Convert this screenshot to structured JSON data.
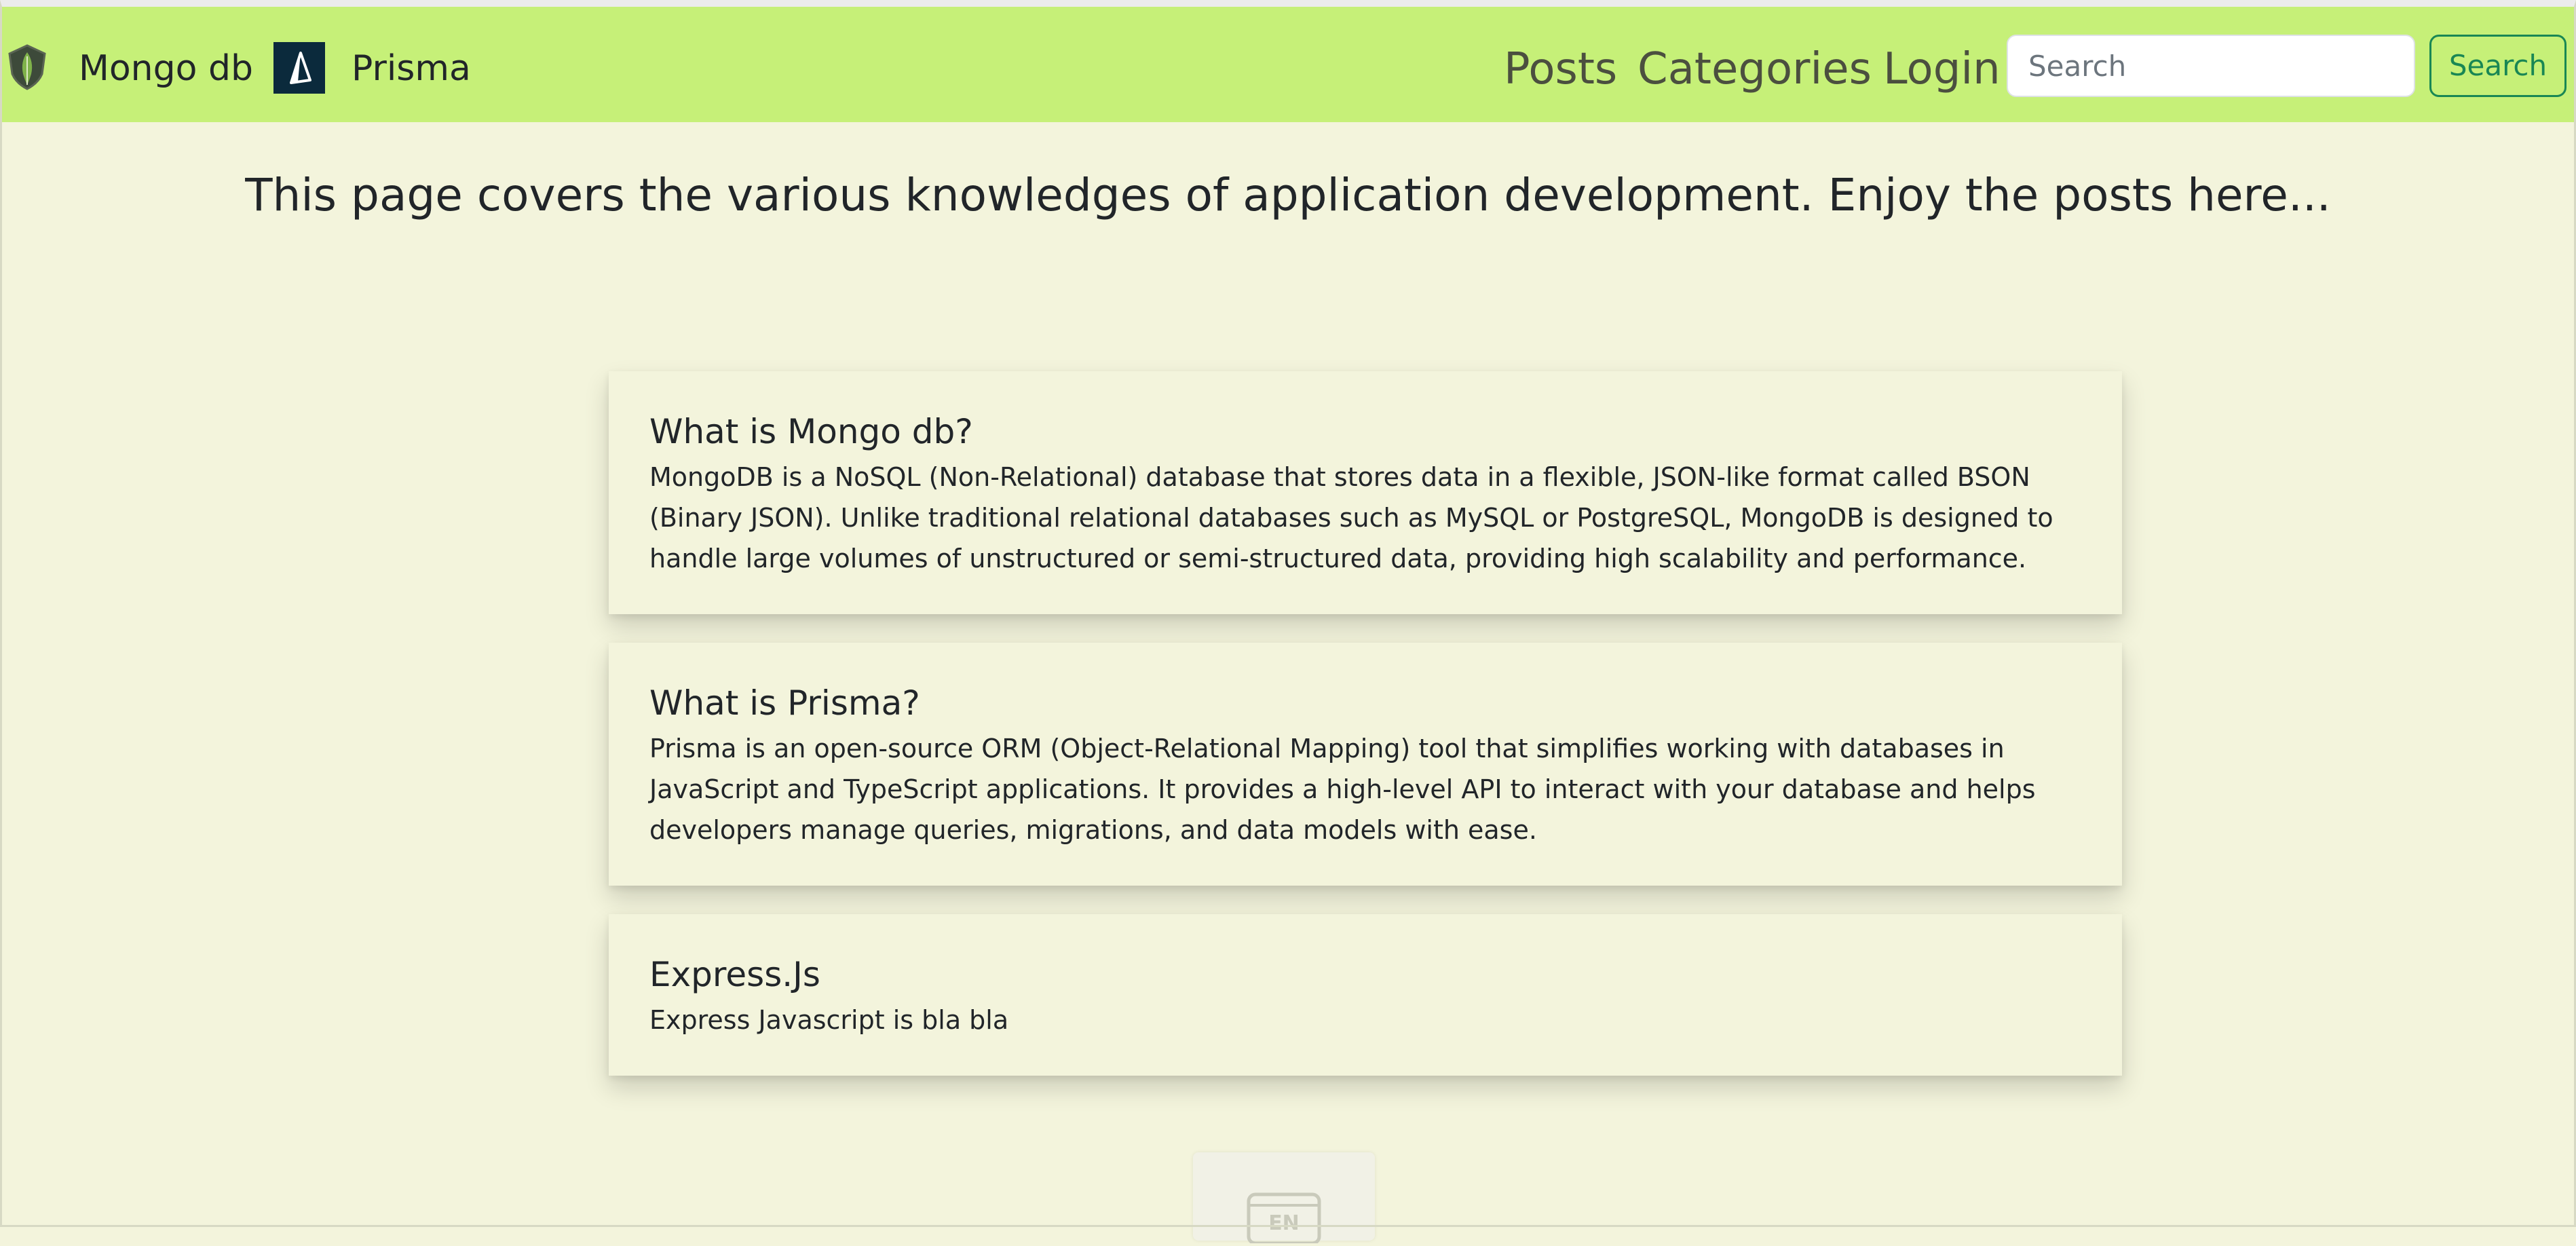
{
  "navbar": {
    "brand_mongo": {
      "label": "Mongo db",
      "icon": "mongodb-leaf-icon"
    },
    "brand_prisma": {
      "label": "Prisma",
      "icon": "prisma-triangle-icon"
    },
    "links": [
      {
        "label": "Posts"
      },
      {
        "label": "Categories"
      },
      {
        "label": "Login"
      }
    ],
    "search": {
      "placeholder": "Search",
      "value": "",
      "button_label": "Search"
    },
    "background_color": "#c6f078"
  },
  "hero": {
    "text": "This page covers the various knowledges of application development. Enjoy the posts here..."
  },
  "posts": [
    {
      "title": "What is Mongo db?",
      "body": "MongoDB is a NoSQL (Non-Relational) database that stores data in a flexible, JSON-like format called BSON (Binary JSON). Unlike traditional relational databases such as MySQL or PostgreSQL, MongoDB is designed to handle large volumes of unstructured or semi-structured data, providing high scalability and performance."
    },
    {
      "title": "What is Prisma?",
      "body": "Prisma is an open-source ORM (Object-Relational Mapping) tool that simplifies working with databases in JavaScript and TypeScript applications. It provides a high-level API to interact with your database and helps developers manage queries, migrations, and data models with ease."
    },
    {
      "title": "Express.Js",
      "body": "Express Javascript is bla bla"
    }
  ],
  "language_widget": {
    "label": "EN",
    "icon": "language-keyboard-icon"
  },
  "colors": {
    "page_background": "#f3f4dc",
    "accent_success": "#198754"
  }
}
